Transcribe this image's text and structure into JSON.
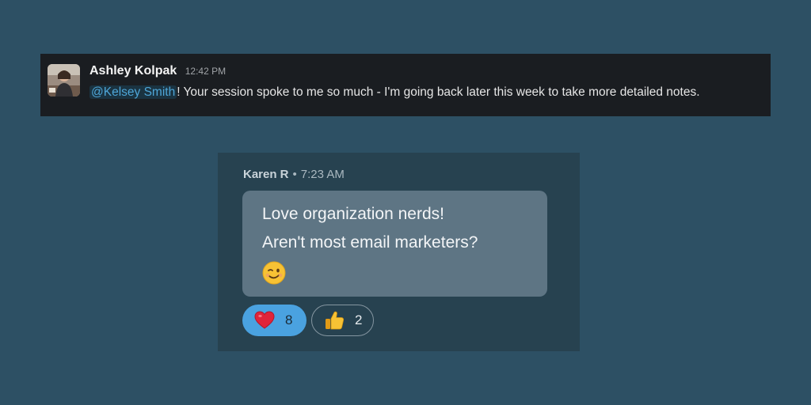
{
  "slack_message": {
    "author": "Ashley Kolpak",
    "time": "12:42 PM",
    "mention": "@Kelsey Smith",
    "text": "! Your session spoke to me so much - I'm going back later this week to take more detailed notes."
  },
  "chat_message": {
    "author": "Karen R",
    "separator": "•",
    "time": "7:23 AM",
    "lines": [
      "Love organization nerds!",
      "Aren't most email marketers?"
    ],
    "emoji": "winking-face-emoji",
    "reactions": [
      {
        "icon": "heart-icon",
        "count": "8",
        "active": true
      },
      {
        "icon": "thumbs-up-icon",
        "count": "2",
        "active": false
      }
    ]
  },
  "colors": {
    "background": "#2d5064",
    "slack_card": "#1a1d21",
    "chat_card": "#274250",
    "bubble": "#5e7584",
    "active_reaction": "#4aa2e0",
    "mention": "#4ea6d8"
  }
}
